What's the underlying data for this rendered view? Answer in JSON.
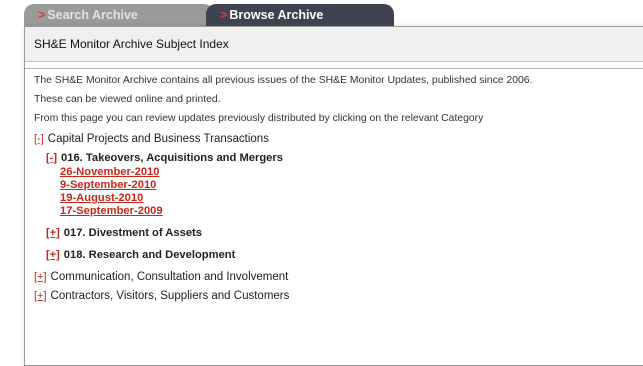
{
  "tabs": {
    "search_label": "Search Archive",
    "browse_label": "Browse Archive",
    "arrow": ">"
  },
  "header": {
    "title": "SH&E Monitor Archive Subject Index"
  },
  "intro": [
    "The SH&E Monitor Archive contains all previous issues of the SH&E Monitor Updates, published since 2006.",
    "These can be viewed online and printed.",
    "From this page you can review updates previously distributed by clicking on the relevant Category"
  ],
  "categories": [
    {
      "toggle": "[-]",
      "label": "Capital Projects and Business Transactions",
      "subcategories": [
        {
          "toggle": "[-]",
          "label": "016. Takeovers, Acquisitions and Mergers",
          "links": [
            "26-November-2010",
            "9-September-2010",
            "19-August-2010",
            "17-September-2009"
          ]
        },
        {
          "toggle": "[+]",
          "label": "017. Divestment of Assets"
        },
        {
          "toggle": "[+]",
          "label": "018. Research and Development"
        }
      ]
    },
    {
      "toggle": "[+]",
      "label": "Communication, Consultation and Involvement"
    },
    {
      "toggle": "[+]",
      "label": "Contractors, Visitors, Suppliers and Customers"
    }
  ],
  "colors": {
    "accent": "#c8271a",
    "active_tab": "#3f4350",
    "inactive_tab": "#9a9a9a"
  }
}
